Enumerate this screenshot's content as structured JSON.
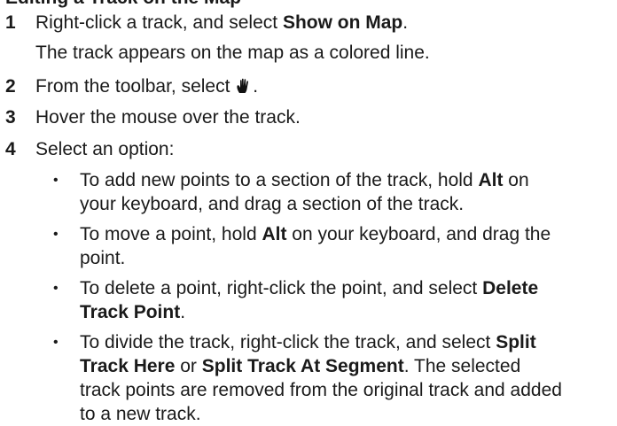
{
  "heading": "Editing a Track on the Map",
  "steps": [
    {
      "num": "1",
      "pre": "Right-click a track, and select ",
      "bold": "Show on Map",
      "post": ".",
      "note": "The track appears on the map as a colored line."
    },
    {
      "num": "2",
      "pre": "From the toolbar, select ",
      "icon": "hand-icon",
      "post": "."
    },
    {
      "num": "3",
      "text": "Hover the mouse over the track."
    },
    {
      "num": "4",
      "text": "Select an option:"
    }
  ],
  "bullets": [
    {
      "l1a": "To add new points to a section of the track, hold ",
      "l1b": "Alt",
      "l1c": " on",
      "l2": "your keyboard, and drag a section of the track."
    },
    {
      "l1a": "To move a point, hold ",
      "l1b": "Alt",
      "l1c": " on your keyboard, and drag the",
      "l2": "point."
    },
    {
      "l1a": "To delete a point, right-click the point, and select ",
      "l1b": "Delete",
      "l2b": "Track Point",
      "l2c": "."
    },
    {
      "l1a": "To divide the track, right-click the track, and select ",
      "l1b": "Split",
      "l2b1": "Track Here",
      "l2c1": " or ",
      "l2b2": "Split Track At Segment",
      "l2c2": ". The selected",
      "l3": "track points are removed from the original track and added",
      "l4": "to a new track."
    }
  ]
}
